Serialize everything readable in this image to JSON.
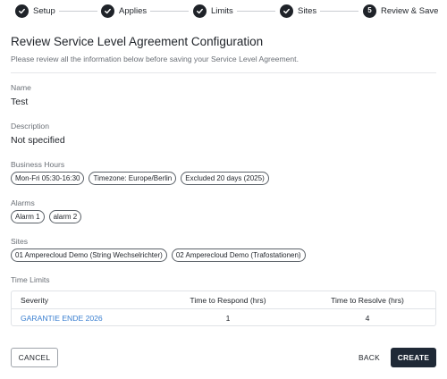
{
  "stepper": {
    "steps": [
      {
        "label": "Setup",
        "state": "complete"
      },
      {
        "label": "Applies",
        "state": "complete"
      },
      {
        "label": "Limits",
        "state": "complete"
      },
      {
        "label": "Sites",
        "state": "complete"
      },
      {
        "label": "Review & Save",
        "state": "active",
        "number": "5"
      }
    ]
  },
  "header": {
    "title": "Review Service Level Agreement Configuration",
    "subtitle": "Please review all the information below before saving your Service Level Agreement."
  },
  "name": {
    "label": "Name",
    "value": "Test"
  },
  "description": {
    "label": "Description",
    "value": "Not specified"
  },
  "business_hours": {
    "label": "Business Hours",
    "chips": [
      "Mon-Fri 05:30-16:30",
      "Timezone: Europe/Berlin",
      "Excluded 20 days (2025)"
    ]
  },
  "alarms": {
    "label": "Alarms",
    "chips": [
      "Alarm 1",
      "alarm 2"
    ]
  },
  "sites": {
    "label": "Sites",
    "chips": [
      "01 Amperecloud Demo (String Wechselrichter)",
      "02 Amperecloud Demo (Trafostationen)"
    ]
  },
  "time_limits": {
    "label": "Time Limits",
    "columns": [
      "Severity",
      "Time to Respond (hrs)",
      "Time to Resolve (hrs)"
    ],
    "rows": [
      {
        "severity": "GARANTIE ENDE 2026",
        "respond": "1",
        "resolve": "4"
      }
    ]
  },
  "actions": {
    "cancel": "CANCEL",
    "back": "BACK",
    "create": "CREATE"
  },
  "colors": {
    "primary": "#1f2936",
    "link": "#3a7fd0",
    "muted_text": "#6b7077"
  }
}
